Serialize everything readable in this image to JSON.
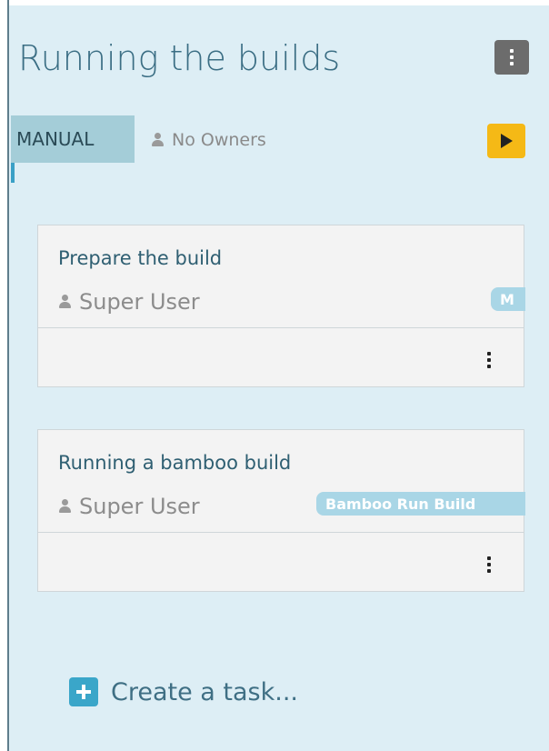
{
  "phase": {
    "title": "Running the builds",
    "type_badge": "MANUAL",
    "owners": "No Owners",
    "icons": {
      "menu": "vertical-dots-icon",
      "play": "play-icon",
      "owner": "user-icon"
    }
  },
  "tasks": [
    {
      "title": "Prepare the build",
      "assignee": "Super User",
      "tag": "M"
    },
    {
      "title": "Running a bamboo build",
      "assignee": "Super User",
      "tag": "Bamboo Run Build"
    }
  ],
  "create_task": {
    "label": "Create a task..."
  },
  "colors": {
    "phase_bg": "#ddeef5",
    "accent": "#3aa6c9",
    "play": "#f5b916",
    "title": "#3b6e84"
  }
}
